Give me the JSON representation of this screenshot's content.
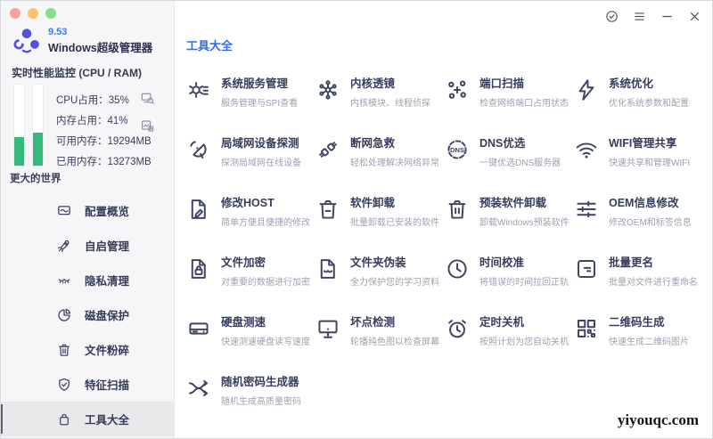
{
  "app": {
    "version": "9.53",
    "name": "Windows超级管理器"
  },
  "performance": {
    "title": "实时性能监控 (CPU / RAM)",
    "cpu_percent": 35,
    "ram_percent": 41,
    "metrics": [
      {
        "label": "CPU占用：",
        "value": "35%"
      },
      {
        "label": "内存占用：",
        "value": "41%"
      },
      {
        "label": "可用内存：",
        "value": "19294MB"
      },
      {
        "label": "已用内存：",
        "value": "13273MB"
      }
    ],
    "action_icons": [
      "screen-search-icon",
      "image-export-icon"
    ]
  },
  "sidebar": {
    "section_label": "更大的世界",
    "nav": [
      {
        "label": "配置概览",
        "icon": "monitor-chart-icon",
        "selected": false
      },
      {
        "label": "自启管理",
        "icon": "rocket-icon",
        "selected": false
      },
      {
        "label": "隐私清理",
        "icon": "closed-eyes-icon",
        "selected": false
      },
      {
        "label": "磁盘保护",
        "icon": "pie-chart-icon",
        "selected": false
      },
      {
        "label": "文件粉碎",
        "icon": "trash-icon",
        "selected": false
      },
      {
        "label": "特征扫描",
        "icon": "shield-check-icon",
        "selected": false
      },
      {
        "label": "工具大全",
        "icon": "bag-icon",
        "selected": true
      }
    ]
  },
  "titlebar": {
    "icons": [
      "badge-check-icon",
      "menu-icon",
      "minimize-icon",
      "close-icon"
    ]
  },
  "main": {
    "title": "工具大全",
    "tools": [
      {
        "title": "系统服务管理",
        "subtitle": "服务管理与SPI查看",
        "icon": "gear-icon"
      },
      {
        "title": "内核透镜",
        "subtitle": "内核模块、线程侦探",
        "icon": "molecule-icon"
      },
      {
        "title": "端口扫描",
        "subtitle": "检查网络端口占用状态",
        "icon": "port-scan-icon"
      },
      {
        "title": "系统优化",
        "subtitle": "优化系统参数和配置",
        "icon": "lightning-icon"
      },
      {
        "title": "局域网设备探测",
        "subtitle": "探测局域网在线设备",
        "icon": "radar-icon"
      },
      {
        "title": "断网急救",
        "subtitle": "轻松处理解决网络异常",
        "icon": "plug-icon"
      },
      {
        "title": "DNS优选",
        "subtitle": "一键优选DNS服务器",
        "icon": "dns-icon"
      },
      {
        "title": "WIFI管理共享",
        "subtitle": "快速共享和管理WIFI",
        "icon": "wifi-icon"
      },
      {
        "title": "修改HOST",
        "subtitle": "简单方便且便捷的修改",
        "icon": "file-edit-icon"
      },
      {
        "title": "软件卸载",
        "subtitle": "批量卸载已安装的软件",
        "icon": "trash-minus-icon"
      },
      {
        "title": "预装软件卸载",
        "subtitle": "卸载Windows预装软件",
        "icon": "trash-pause-icon"
      },
      {
        "title": "OEM信息修改",
        "subtitle": "修改OEM和标签信息",
        "icon": "sliders-icon"
      },
      {
        "title": "文件加密",
        "subtitle": "对重要的数据进行加密",
        "icon": "file-lock-icon"
      },
      {
        "title": "文件夹伪装",
        "subtitle": "全力保护您的学习资料",
        "icon": "file-mask-icon"
      },
      {
        "title": "时间校准",
        "subtitle": "将错误的时间拉回正轨",
        "icon": "clock-icon"
      },
      {
        "title": "批量更名",
        "subtitle": "批量对文件进行重命名",
        "icon": "rename-icon"
      },
      {
        "title": "硬盘测速",
        "subtitle": "快速测速硬盘读写速度",
        "icon": "hdd-icon"
      },
      {
        "title": "坏点检测",
        "subtitle": "轮播纯色图以检查屏幕",
        "icon": "monitor-icon"
      },
      {
        "title": "定时关机",
        "subtitle": "按照计划为您自动关机",
        "icon": "alarm-icon"
      },
      {
        "title": "二维码生成",
        "subtitle": "快速生成二维码图片",
        "icon": "qr-icon"
      },
      {
        "title": "随机密码生成器",
        "subtitle": "随机生成高质量密码",
        "icon": "shuffle-icon"
      }
    ]
  },
  "watermark": "yiyouqc.com",
  "colors": {
    "accent": "#2f6bf6",
    "icon_navy": "#3e4464",
    "bar_green": "#35ba7c",
    "version_blue": "#3b7cf6",
    "logo_purple": "#5551d8"
  }
}
